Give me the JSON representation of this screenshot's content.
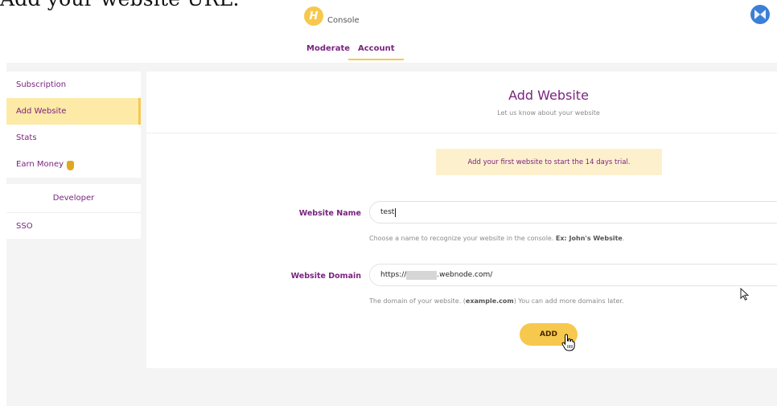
{
  "caption": "Add your website URL.",
  "header": {
    "logo_letter": "H",
    "logo_text": "Console",
    "tabs": [
      {
        "label": "Moderate",
        "active": false
      },
      {
        "label": "Account",
        "active": true
      }
    ],
    "accent_color": "#f6c84d",
    "brand_color": "#7a2380"
  },
  "sidebar": {
    "items": [
      {
        "label": "Subscription",
        "active": false
      },
      {
        "label": "Add Website",
        "active": true
      },
      {
        "label": "Stats",
        "active": false
      },
      {
        "label": "Earn Money",
        "active": false,
        "icon": "medal-icon"
      }
    ],
    "developer": {
      "header": "Developer",
      "items": [
        {
          "label": "SSO"
        }
      ]
    }
  },
  "main": {
    "title": "Add Website",
    "subtitle": "Let us know about your website",
    "notice": "Add your first website to start the 14 days trial.",
    "website_name": {
      "label": "Website Name",
      "value": "test",
      "help_prefix": "Choose a name to recognize your website in the console. ",
      "help_bold": "Ex: John's Website",
      "help_suffix": "."
    },
    "website_domain": {
      "label": "Website Domain",
      "value_prefix": "https://",
      "value_suffix": ".webnode.com/",
      "help_prefix": "The domain of your website. (",
      "help_bold": "example.com",
      "help_suffix": ") You can add more domains later."
    },
    "add_button": "ADD"
  }
}
